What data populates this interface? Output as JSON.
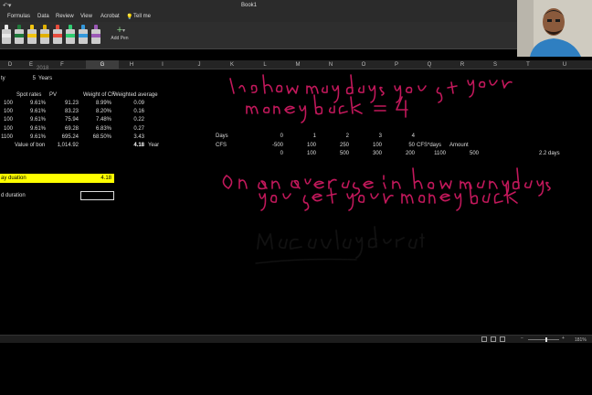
{
  "window": {
    "title": "Book1"
  },
  "menu": [
    "Formulas",
    "Data",
    "Review",
    "View",
    "Acrobat",
    "Tell me"
  ],
  "ribbon": {
    "add_pen_label": "Add Pen",
    "pen_colors": [
      "#e8e8e8",
      "#1e7a3a",
      "#f1c40f",
      "#e0b000",
      "#e74c3c",
      "#2ecc71",
      "#3498db",
      "#9b59b6",
      "#d0d0d0"
    ]
  },
  "columns": [
    "D",
    "E",
    "F",
    "G",
    "H",
    "I",
    "J",
    "K",
    "L",
    "M",
    "N",
    "O",
    "P",
    "Q",
    "R",
    "S",
    "T",
    "U"
  ],
  "selected_column": "G",
  "sheet": {
    "top_partial": "2018",
    "tenor_label": "ty",
    "tenor_value": "5",
    "tenor_unit": "Years",
    "headers": [
      "Spot rates",
      "PV",
      "Weight of CF",
      "Weighted average"
    ],
    "rows": [
      {
        "cf": "100",
        "rate": "9.61%",
        "pv": "91.23",
        "weight": "8.99%",
        "wavg": "0.09"
      },
      {
        "cf": "100",
        "rate": "9.61%",
        "pv": "83.23",
        "weight": "8.20%",
        "wavg": "0.16"
      },
      {
        "cf": "100",
        "rate": "9.61%",
        "pv": "75.94",
        "weight": "7.48%",
        "wavg": "0.22"
      },
      {
        "cf": "100",
        "rate": "9.61%",
        "pv": "69.28",
        "weight": "6.83%",
        "wavg": "0.27"
      },
      {
        "cf": "1100",
        "rate": "9.61%",
        "pv": "695.24",
        "weight": "68.50%",
        "wavg": "3.43"
      }
    ],
    "value_label": "Value of bon",
    "value_amount": "1,014.92",
    "total_wavg": "4.18",
    "total_unit": "Year",
    "duration_label": "ay duation",
    "duration_value": "4.18",
    "modified_label": "d duration",
    "side_table": {
      "days_label": "Days",
      "days": [
        "0",
        "1",
        "2",
        "3",
        "4"
      ],
      "cfs_label": "CFS",
      "cfs": [
        "-500",
        "100",
        "250",
        "100",
        "50"
      ],
      "cfs_days_label": "CFS*days",
      "amount_label": "Amount",
      "products": [
        "0",
        "100",
        "500",
        "300",
        "200"
      ],
      "sum_products": "1100",
      "amount": "500",
      "result": "2.2 days"
    }
  },
  "statusbar": {
    "zoom": "181%"
  }
}
